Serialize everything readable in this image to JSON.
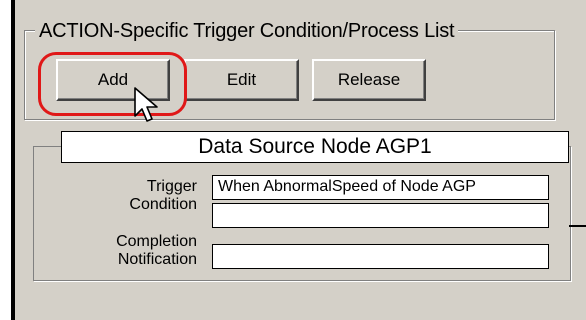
{
  "group": {
    "title": "ACTION-Specific Trigger Condition/Process List"
  },
  "buttons": {
    "add": "Add",
    "edit": "Edit",
    "release": "Release"
  },
  "node": {
    "title": "Data Source Node AGP1",
    "trigger_label_1": "Trigger",
    "trigger_label_2": "Condition",
    "trigger_value_1": "When  AbnormalSpeed  of  Node AGP",
    "trigger_value_2": "",
    "completion_label_1": "Completion",
    "completion_label_2": "Notification",
    "completion_value": ""
  },
  "colors": {
    "panel": "#d4d0c8",
    "highlight": "#e01818"
  },
  "icons": {
    "cursor": "mouse-pointer-icon"
  }
}
